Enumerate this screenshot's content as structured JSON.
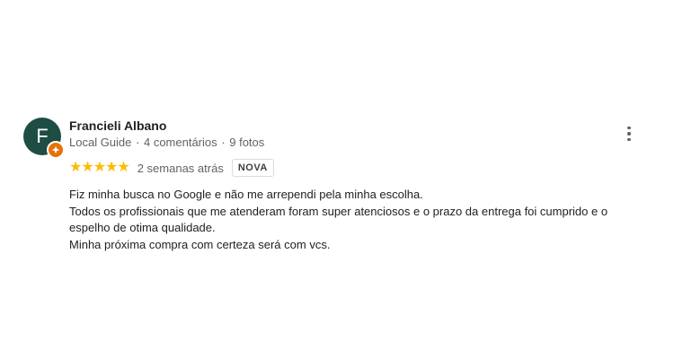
{
  "review": {
    "avatar_letter": "F",
    "avatar_color": "#1e4d44",
    "badge_icon": "local-guide-badge-icon",
    "author_name": "Francieli Albano",
    "author_status": "Local Guide",
    "comments_count": "4 comentários",
    "photos_count": "9 fotos",
    "meta_separator": "·",
    "rating": 5,
    "rating_max": 5,
    "stars_color": "#fbbc04",
    "time_ago": "2 semanas atrás",
    "new_badge": "NOVA",
    "more_icon": "more-vert-icon",
    "text_lines": [
      "Fiz minha busca no Google e não me arrependi pela minha escolha.",
      "Todos os profissionais que me atenderam foram super atenciosos e o prazo da entrega foi cumprido e o",
      "espelho de otima qualidade.",
      "Minha próxima compra com certeza será com vcs."
    ]
  }
}
